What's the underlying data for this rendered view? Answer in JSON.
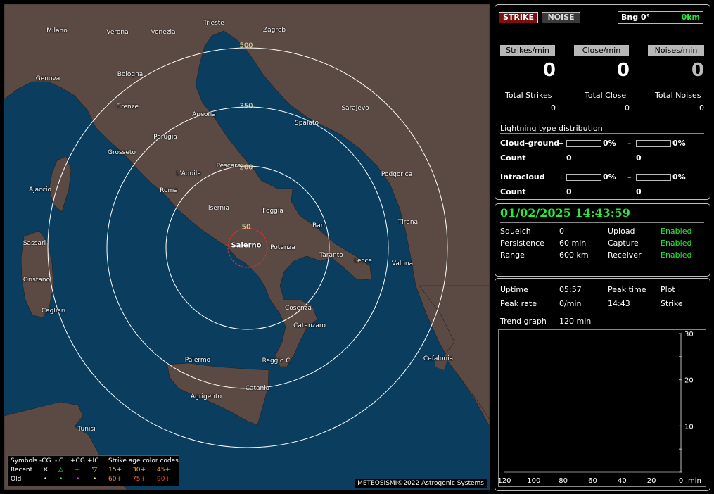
{
  "map": {
    "center_city": "Salerno",
    "ring_labels": [
      "50",
      "200",
      "350",
      "500"
    ],
    "cities": [
      "Milano",
      "Verona",
      "Venezia",
      "Trieste",
      "Zagreb",
      "Genova",
      "Bologna",
      "Firenze",
      "Ancona",
      "Perugia",
      "Sarajevo",
      "Spalato",
      "Grosseto",
      "L'Aquila",
      "Pescara",
      "Podgorica",
      "Roma",
      "Ajaccio",
      "Isernia",
      "Foggia",
      "Bari",
      "Tirana",
      "Sassari",
      "Potenza",
      "Taranto",
      "Lecce",
      "Valona",
      "Oristano",
      "Cagliari",
      "Cosenza",
      "Catanzaro",
      "Palermo",
      "Reggio C.",
      "Cefalonia",
      "Catania",
      "Agrigento",
      "Tunisi"
    ],
    "copyright": "METEOSISMI©2022 Astrogenic Systems",
    "legend": {
      "symbols_label": "Symbols",
      "cols": [
        "-CG",
        "-IC",
        "+CG",
        "+IC"
      ],
      "recent_label": "Recent",
      "old_label": "Old",
      "recent_symbols": [
        "✕",
        "△",
        "+",
        "▽"
      ],
      "old_symbols": [
        "•",
        "•",
        "•",
        "•"
      ],
      "age_title": "Strike age color codes",
      "age_codes": [
        "15+",
        "30+",
        "45+",
        "60+",
        "75+",
        "90+"
      ]
    },
    "colors": {
      "sea": "#0b3d5e",
      "land": "#5b4a43",
      "center": "#e03030",
      "ring": "#ffffff",
      "ring_label": "#e8e39a"
    }
  },
  "panel_top": {
    "strike_btn": "STRIKE",
    "noise_btn": "NOISE",
    "bearing": "Bng 0°",
    "distance": "0km",
    "rate_labels": [
      "Strikes/min",
      "Close/min",
      "Noises/min"
    ],
    "rate_values": [
      "0",
      "0",
      "0"
    ],
    "total_labels": [
      "Total Strikes",
      "Total Close",
      "Total Noises"
    ],
    "total_values": [
      "0",
      "0",
      "0"
    ],
    "dist_title": "Lightning type distribution",
    "cloud_ground": {
      "label": "Cloud-ground",
      "plus_pct": "0%",
      "minus_pct": "0%",
      "count_label": "Count",
      "plus_count": "0",
      "minus_count": "0",
      "plus_fill": 0,
      "minus_fill": 0
    },
    "intracloud": {
      "label": "Intracloud",
      "plus_pct": "0%",
      "minus_pct": "0%",
      "count_label": "Count",
      "plus_count": "0",
      "minus_count": "0",
      "plus_fill": 0,
      "minus_fill": 0
    },
    "plus_sign": "+",
    "minus_sign": "–"
  },
  "panel_status": {
    "datetime": "01/02/2025 14:43:59",
    "rows": [
      {
        "k1": "Squelch",
        "v1": "0",
        "k2": "Upload",
        "v2": "Enabled"
      },
      {
        "k1": "Persistence",
        "v1": "60 min",
        "k2": "Capture",
        "v2": "Enabled"
      },
      {
        "k1": "Range",
        "v1": "600 km",
        "k2": "Receiver",
        "v2": "Enabled"
      }
    ]
  },
  "panel_trend": {
    "uptime_label": "Uptime",
    "uptime": "05:57",
    "peak_time_label": "Peak time",
    "peak_time": "14:43",
    "plot_label": "Plot",
    "plot": "Strike",
    "peak_rate_label": "Peak rate",
    "peak_rate": "0/min",
    "trend_label": "Trend graph",
    "trend": "120 min"
  },
  "chart_data": {
    "type": "line",
    "x_ticks": [
      "120",
      "100",
      "80",
      "60",
      "40",
      "20",
      "0"
    ],
    "x_unit": "min",
    "y_ticks": [
      "30",
      "20",
      "10"
    ],
    "ylim": [
      0,
      30
    ],
    "xlim": [
      120,
      0
    ],
    "series": [
      {
        "values": []
      }
    ]
  }
}
